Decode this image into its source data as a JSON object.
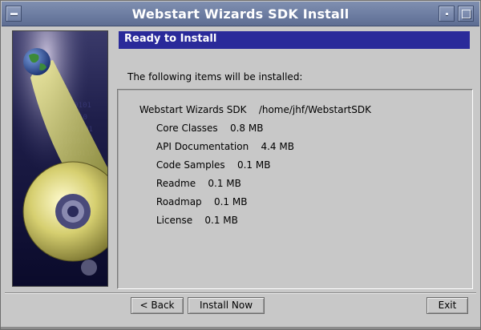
{
  "window": {
    "title": "Webstart Wizards SDK Install"
  },
  "heading": "Ready to Install",
  "intro": "The following items will be installed:",
  "items": {
    "root": {
      "name": "Webstart Wizards SDK",
      "path": "/home/jhf/WebstartSDK"
    },
    "children": [
      {
        "name": "Core Classes",
        "size": "0.8 MB"
      },
      {
        "name": "API Documentation",
        "size": "4.4 MB"
      },
      {
        "name": "Code Samples",
        "size": "0.1 MB"
      },
      {
        "name": "Readme",
        "size": "0.1 MB"
      },
      {
        "name": "Roadmap",
        "size": "0.1 MB"
      },
      {
        "name": "License",
        "size": "0.1 MB"
      }
    ]
  },
  "buttons": {
    "back": "< Back",
    "install": "Install Now",
    "exit": "Exit"
  },
  "colors": {
    "title_bar": "#6b7ba0",
    "heading_bg": "#2a2a9a",
    "dialog_bg": "#c8c8c8"
  }
}
